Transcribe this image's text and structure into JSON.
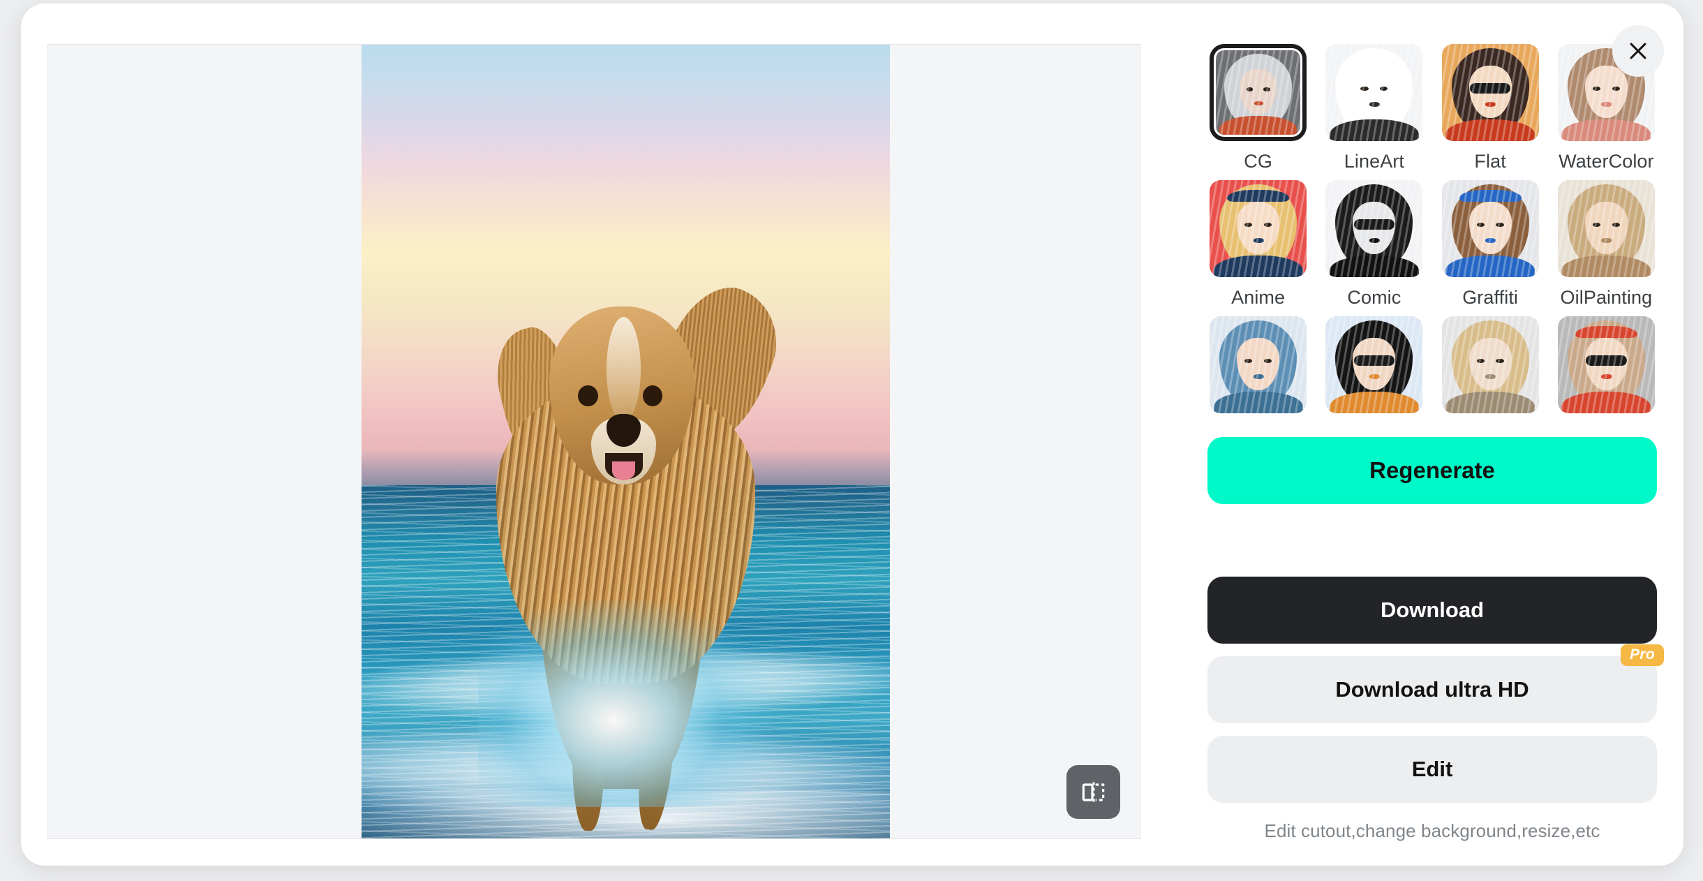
{
  "modal": {
    "close_label": "Close",
    "close_icon": "close-icon"
  },
  "canvas": {
    "preview_alt": "Golden retriever dog running through ocean waves at pastel sunset",
    "compare_icon": "before-after-compare-icon",
    "compare_label": "Compare before and after"
  },
  "styles": {
    "selected": "CG",
    "items": [
      {
        "label": "CG",
        "selected": true,
        "bg": "#6e6f72",
        "hair": "#cfd2d6",
        "face": "#e8d4c8",
        "accent": "#c8502e"
      },
      {
        "label": "LineArt",
        "selected": false,
        "bg": "#f3f4f6",
        "hair": "#ffffff",
        "face": "#ffffff",
        "accent": "#2b2b2b"
      },
      {
        "label": "Flat",
        "selected": false,
        "bg": "#e8a85c",
        "hair": "#3b2822",
        "face": "#f3d9c2",
        "accent": "#c83a1e"
      },
      {
        "label": "WaterColor",
        "selected": false,
        "bg": "#f1f2f4",
        "hair": "#b08a6e",
        "face": "#f5ddcd",
        "accent": "#d98a7a"
      },
      {
        "label": "Anime",
        "selected": false,
        "bg": "#e8504c",
        "hair": "#e7c070",
        "face": "#f6dcc6",
        "accent": "#1f3a5f"
      },
      {
        "label": "Comic",
        "selected": false,
        "bg": "#f2f3f5",
        "hair": "#1b1b1b",
        "face": "#e6e7e9",
        "accent": "#111111"
      },
      {
        "label": "Graffiti",
        "selected": false,
        "bg": "#e4e6ea",
        "hair": "#8c5f3c",
        "face": "#f4dccb",
        "accent": "#2566c4"
      },
      {
        "label": "OilPainting",
        "selected": false,
        "bg": "#e9e2d6",
        "hair": "#c9ab7e",
        "face": "#f0d6bd",
        "accent": "#b08a62"
      },
      {
        "label": "",
        "selected": false,
        "bg": "#dde6ef",
        "hair": "#5d8fb5",
        "face": "#f3d8c6",
        "accent": "#3b6f94"
      },
      {
        "label": "",
        "selected": false,
        "bg": "#dce8f4",
        "hair": "#141414",
        "face": "#f0d7c4",
        "accent": "#e08a2e"
      },
      {
        "label": "",
        "selected": false,
        "bg": "#e4e4e4",
        "hair": "#d8bd8b",
        "face": "#efdccb",
        "accent": "#9c8b72"
      },
      {
        "label": "",
        "selected": false,
        "bg": "#b9b9b9",
        "hair": "#caa98a",
        "face": "#f1d8c3",
        "accent": "#d8452e"
      }
    ]
  },
  "actions": {
    "regenerate_label": "Regenerate",
    "download_label": "Download",
    "download_ultra_hd_label": "Download ultra HD",
    "download_ultra_hd_badge": "Pro",
    "edit_label": "Edit",
    "helper_text": "Edit cutout,change background,resize,etc"
  },
  "colors": {
    "accent_green": "#00f9c8",
    "dark": "#232428",
    "soft_grey": "#eceef0",
    "pro_amber": "#f5b844",
    "helper_grey": "#80868b"
  }
}
